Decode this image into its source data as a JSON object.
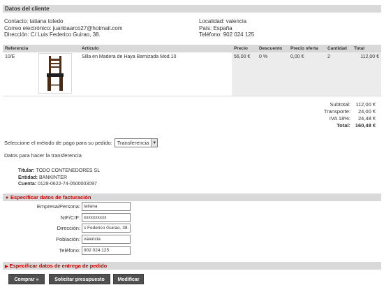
{
  "client_section": {
    "title": "Datos del cliente"
  },
  "contact": {
    "contact_line": "Contacto: tatiana toledo",
    "email_line": "Correo electrónico: juanbaarco27@hotmail.com",
    "address_line": "Dirección: C/ Luis Federico Guirao, 38.",
    "locality_line": "Localidad: valencia",
    "country_line": "País: España",
    "phone_line": "Teléfono: 902 024 125"
  },
  "order_table": {
    "headers": [
      "Referencia",
      "Artículo",
      "Precio",
      "Descuento",
      "Precio oferta",
      "Cantidad",
      "Total"
    ],
    "rows": [
      {
        "reference": "10/E",
        "article": "Silla en Madera de Haya Barnizada Mod.10",
        "price": "56,00 €",
        "discount": "0 %",
        "offer_price": "0,00 €",
        "quantity": "2",
        "total": "112,00 €",
        "image_icon": "chair-image"
      }
    ]
  },
  "totals": {
    "subtotal_label": "Subtotal:",
    "subtotal_value": "112,00 €",
    "shipping_label": "Transporte:",
    "shipping_value": "24,00 €",
    "vat_label": "IVA 18%:",
    "vat_value": "24,48 €",
    "total_label": "Total:",
    "total_value": "160,48 €"
  },
  "payment": {
    "label": "Seleccione el método de pago para su pedido:",
    "selected": "Transferencia"
  },
  "transfer": {
    "title": "Datos para hacer la transferencia",
    "holder_label": "Titular:",
    "holder_value": "TODO CONTENEDORES SL",
    "entity_label": "Entidad:",
    "entity_value": "BANKINTER",
    "account_label": "Cuenta:",
    "account_value": "0128-0622-74-0500003097"
  },
  "billing": {
    "title": "Especificar datos de facturación",
    "fields": [
      {
        "label": "Empresa/Persona:",
        "value": "tatiana"
      },
      {
        "label": "NIF/CIF:",
        "value": "xxxxxxxxxx"
      },
      {
        "label": "Dirección:",
        "value": "s Federico Guirao, 38."
      },
      {
        "label": "Población:",
        "value": "valencia"
      },
      {
        "label": "Teléfono:",
        "value": "902 024 125"
      }
    ]
  },
  "delivery": {
    "title": "Especificar datos de entrega de pedido"
  },
  "buttons": {
    "buy": "Comprar »",
    "quote": "Solicitar presupuesto",
    "modify": "Modificar"
  },
  "colors": {
    "accent_red": "#cc0000",
    "header_gray": "#d9d9d9",
    "button_dark": "#505050"
  }
}
